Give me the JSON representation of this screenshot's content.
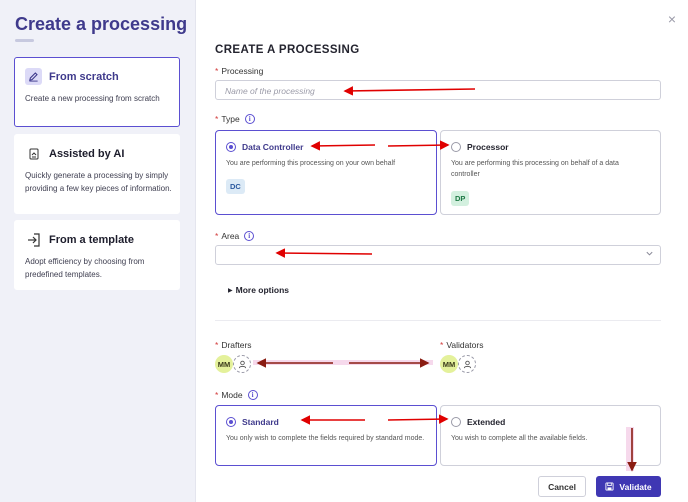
{
  "sidebar": {
    "title": "Create a processing",
    "options": [
      {
        "label": "From scratch",
        "description": "Create a new processing from scratch",
        "icon": "pencil-icon",
        "active": true
      },
      {
        "label": "Assisted by AI",
        "description": "Quickly generate a processing by simply providing a few key pieces of information.",
        "icon": "ai-assist-icon",
        "active": false
      },
      {
        "label": "From a template",
        "description": "Adopt efficiency by choosing from predefined templates.",
        "icon": "template-import-icon",
        "active": false
      }
    ]
  },
  "close_icon": "×",
  "main": {
    "title": "CREATE A PROCESSING",
    "required_mark": "*",
    "processing": {
      "label": "Processing",
      "placeholder": "Name of the processing",
      "value": ""
    },
    "type": {
      "label": "Type",
      "info": "i",
      "options": [
        {
          "title": "Data Controller",
          "description": "You are performing this processing on your own behalf",
          "badge": "DC",
          "selected": true
        },
        {
          "title": "Processor",
          "description": "You are performing this processing on behalf of a data controller",
          "badge": "DP",
          "selected": false
        }
      ]
    },
    "area": {
      "label": "Area",
      "info": "i",
      "value": ""
    },
    "more_options": "More options",
    "drafters": {
      "label": "Drafters",
      "avatar": "MM"
    },
    "validators": {
      "label": "Validators",
      "avatar": "MM"
    },
    "mode": {
      "label": "Mode",
      "info": "i",
      "options": [
        {
          "title": "Standard",
          "description": "You only wish to complete the fields required by standard mode.",
          "selected": true
        },
        {
          "title": "Extended",
          "description": "You wish to complete all the available fields.",
          "selected": false
        }
      ]
    },
    "buttons": {
      "cancel": "Cancel",
      "validate": "Validate"
    }
  },
  "colors": {
    "accent": "#5b4fd1",
    "primary_button": "#3f37b3",
    "annotation_arrow": "#e00000",
    "annotation_arrow_dark": "#8a1c12"
  }
}
